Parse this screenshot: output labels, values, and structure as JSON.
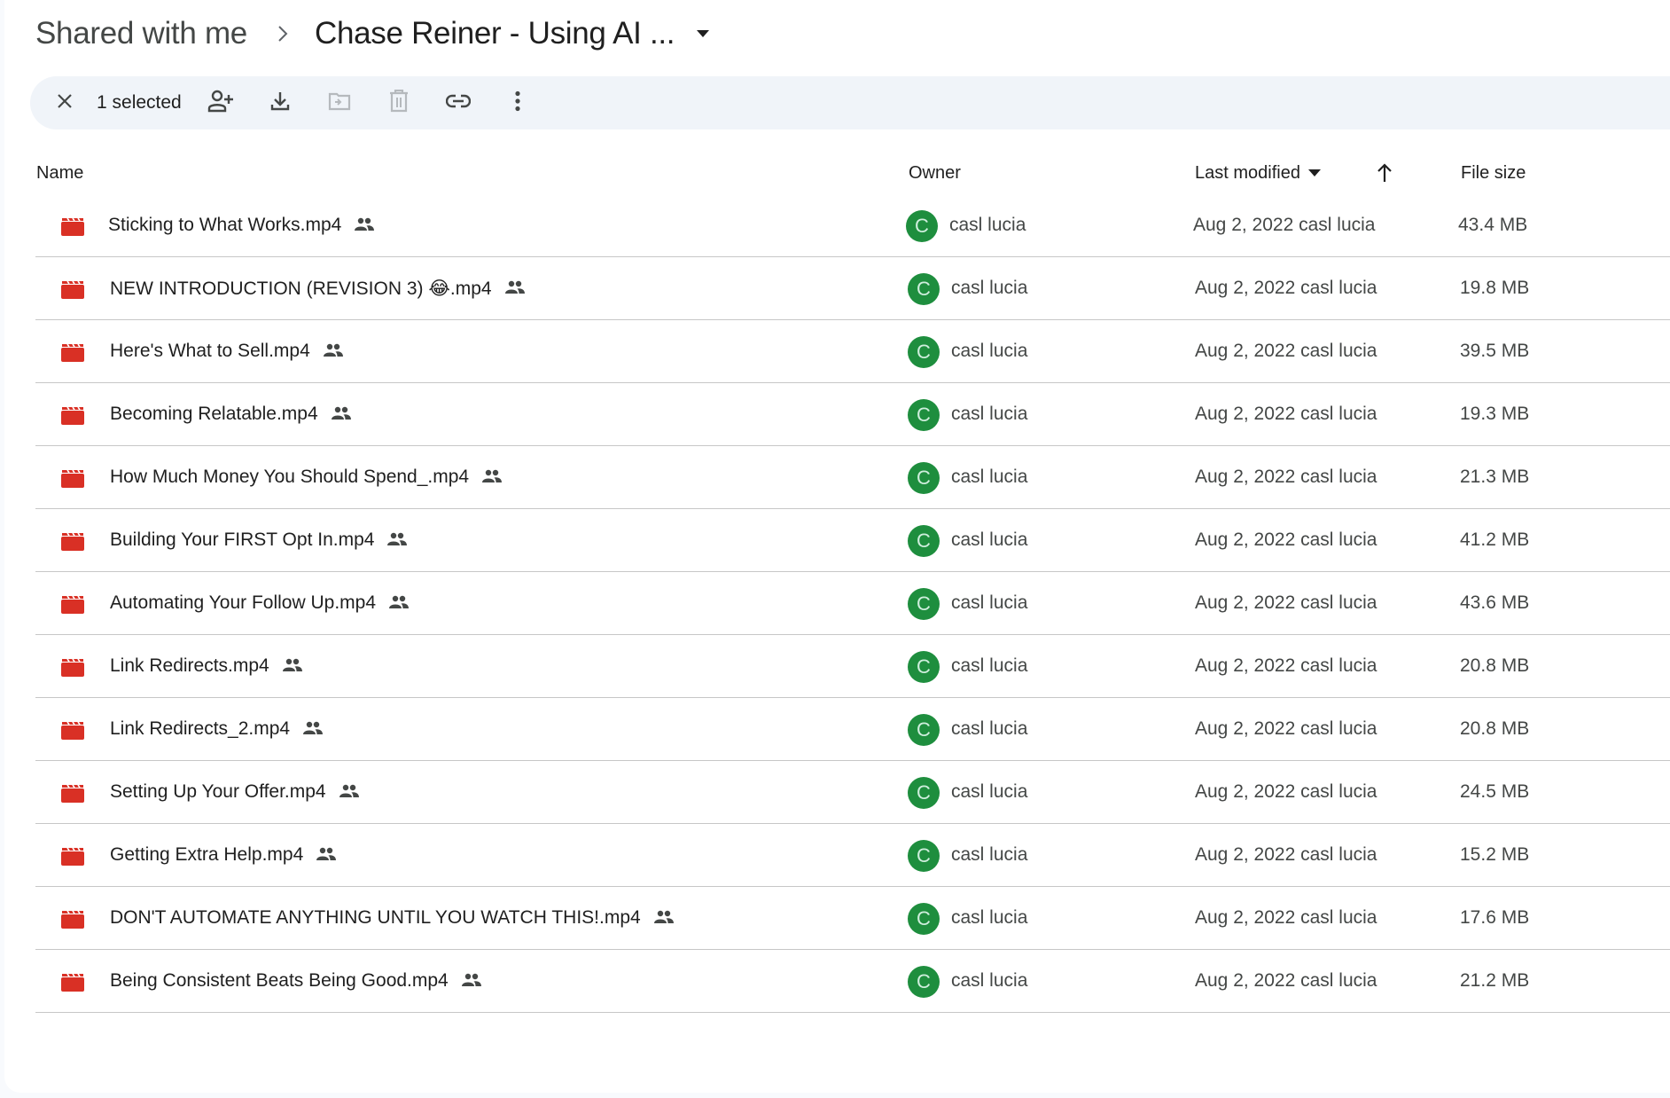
{
  "breadcrumb": {
    "root": "Shared with me",
    "separator_icon": "chevron-right-icon",
    "current": "Chase Reiner - Using AI ...",
    "caret_icon": "caret-down-icon"
  },
  "selection_toolbar": {
    "close_icon": "close-icon",
    "count_label": "1 selected",
    "actions": [
      {
        "name": "share",
        "icon": "person-add-icon",
        "enabled": true
      },
      {
        "name": "download",
        "icon": "download-icon",
        "enabled": true
      },
      {
        "name": "move",
        "icon": "folder-move-icon",
        "enabled": false
      },
      {
        "name": "remove",
        "icon": "trash-icon",
        "enabled": false
      },
      {
        "name": "copy-link",
        "icon": "link-icon",
        "enabled": true
      },
      {
        "name": "more-actions",
        "icon": "more-vert-icon",
        "enabled": true
      }
    ]
  },
  "table": {
    "columns": {
      "name": "Name",
      "owner": "Owner",
      "last_modified": "Last modified",
      "sort_direction_icon": "arrow-up-icon",
      "file_size": "File size"
    },
    "rows": [
      {
        "name": "Sticking to What Works.mp4",
        "owner": "casl lucia",
        "owner_initial": "C",
        "modified": "Aug 2, 2022 casl lucia",
        "size": "43.4 MB"
      },
      {
        "name": "NEW INTRODUCTION (REVISION 3) 😂.mp4",
        "owner": "casl lucia",
        "owner_initial": "C",
        "modified": "Aug 2, 2022 casl lucia",
        "size": "19.8 MB"
      },
      {
        "name": "Here's What to Sell.mp4",
        "owner": "casl lucia",
        "owner_initial": "C",
        "modified": "Aug 2, 2022 casl lucia",
        "size": "39.5 MB"
      },
      {
        "name": "Becoming Relatable.mp4",
        "owner": "casl lucia",
        "owner_initial": "C",
        "modified": "Aug 2, 2022 casl lucia",
        "size": "19.3 MB"
      },
      {
        "name": "How Much Money You Should Spend_.mp4",
        "owner": "casl lucia",
        "owner_initial": "C",
        "modified": "Aug 2, 2022 casl lucia",
        "size": "21.3 MB"
      },
      {
        "name": "Building Your FIRST Opt In.mp4",
        "owner": "casl lucia",
        "owner_initial": "C",
        "modified": "Aug 2, 2022 casl lucia",
        "size": "41.2 MB"
      },
      {
        "name": "Automating Your Follow Up.mp4",
        "owner": "casl lucia",
        "owner_initial": "C",
        "modified": "Aug 2, 2022 casl lucia",
        "size": "43.6 MB"
      },
      {
        "name": "Link Redirects.mp4",
        "owner": "casl lucia",
        "owner_initial": "C",
        "modified": "Aug 2, 2022 casl lucia",
        "size": "20.8 MB"
      },
      {
        "name": "Link Redirects_2.mp4",
        "owner": "casl lucia",
        "owner_initial": "C",
        "modified": "Aug 2, 2022 casl lucia",
        "size": "20.8 MB"
      },
      {
        "name": "Setting Up Your Offer.mp4",
        "owner": "casl lucia",
        "owner_initial": "C",
        "modified": "Aug 2, 2022 casl lucia",
        "size": "24.5 MB"
      },
      {
        "name": "Getting Extra Help.mp4",
        "owner": "casl lucia",
        "owner_initial": "C",
        "modified": "Aug 2, 2022 casl lucia",
        "size": "15.2 MB"
      },
      {
        "name": "DON'T AUTOMATE ANYTHING UNTIL YOU WATCH THIS!.mp4",
        "owner": "casl lucia",
        "owner_initial": "C",
        "modified": "Aug 2, 2022 casl lucia",
        "size": "17.6 MB"
      },
      {
        "name": "Being Consistent Beats Being Good.mp4",
        "owner": "casl lucia",
        "owner_initial": "C",
        "modified": "Aug 2, 2022 casl lucia",
        "size": "21.2 MB"
      }
    ]
  },
  "colors": {
    "video_icon": "#d93025",
    "avatar_bg": "#1e8e3e",
    "toolbar_bg": "#f0f4f9",
    "divider": "#c7c7c7",
    "disabled_icon": "#b5b9bd",
    "icon": "#444746"
  }
}
